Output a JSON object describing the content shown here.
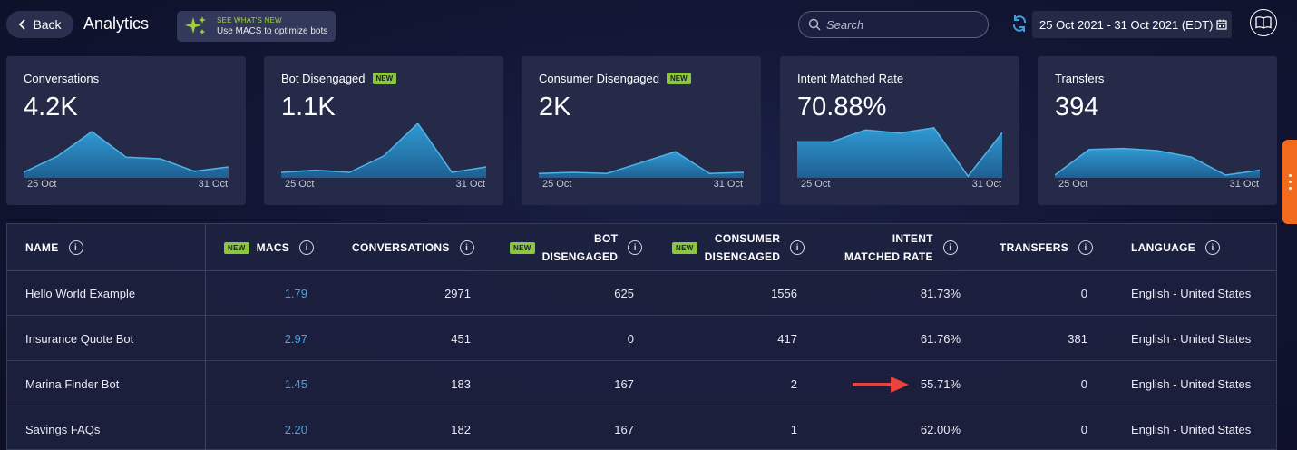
{
  "header": {
    "back_label": "Back",
    "title": "Analytics",
    "promo_top": "SEE WHAT'S NEW",
    "promo_bottom": "Use MACS to optimize bots",
    "search_placeholder": "Search",
    "date_range": "25 Oct 2021 - 31 Oct 2021 (EDT)"
  },
  "badge_text": "NEW",
  "cards": [
    {
      "title": "Conversations",
      "value": "4.2K",
      "new": false,
      "x_start": "25 Oct",
      "x_end": "31 Oct",
      "series": [
        10,
        40,
        85,
        38,
        35,
        12,
        20
      ],
      "y_max": 100
    },
    {
      "title": "Bot Disengaged",
      "value": "1.1K",
      "new": true,
      "x_start": "25 Oct",
      "x_end": "31 Oct",
      "series": [
        10,
        14,
        10,
        40,
        100,
        10,
        20
      ],
      "y_max": 100
    },
    {
      "title": "Consumer Disengaged",
      "value": "2K",
      "new": true,
      "x_start": "25 Oct",
      "x_end": "31 Oct",
      "series": [
        8,
        10,
        8,
        28,
        48,
        8,
        10
      ],
      "y_max": 100
    },
    {
      "title": "Intent Matched Rate",
      "value": "70.88%",
      "new": false,
      "x_start": "25 Oct",
      "x_end": "31 Oct",
      "series": [
        66,
        66,
        88,
        82,
        92,
        3,
        83
      ],
      "y_max": 100
    },
    {
      "title": "Transfers",
      "value": "394",
      "new": false,
      "x_start": "25 Oct",
      "x_end": "31 Oct",
      "series": [
        5,
        52,
        54,
        50,
        38,
        5,
        14
      ],
      "y_max": 100
    }
  ],
  "table": {
    "headers": {
      "name": "NAME",
      "macs": "MACS",
      "conversations": "CONVERSATIONS",
      "bot_disengaged_1": "BOT",
      "bot_disengaged_2": "DISENGAGED",
      "consumer_disengaged_1": "CONSUMER",
      "consumer_disengaged_2": "DISENGAGED",
      "intent_1": "INTENT",
      "intent_2": "MATCHED RATE",
      "transfers": "TRANSFERS",
      "language": "LANGUAGE"
    },
    "rows": [
      {
        "name": "Hello World Example",
        "macs": "1.79",
        "conversations": "2971",
        "bot_disengaged": "625",
        "consumer_disengaged": "1556",
        "intent_matched_rate": "81.73%",
        "transfers": "0",
        "language": "English - United States"
      },
      {
        "name": "Insurance Quote Bot",
        "macs": "2.97",
        "conversations": "451",
        "bot_disengaged": "0",
        "consumer_disengaged": "417",
        "intent_matched_rate": "61.76%",
        "transfers": "381",
        "language": "English - United States"
      },
      {
        "name": "Marina Finder Bot",
        "macs": "1.45",
        "conversations": "183",
        "bot_disengaged": "167",
        "consumer_disengaged": "2",
        "intent_matched_rate": "55.71%",
        "transfers": "0",
        "language": "English - United States"
      },
      {
        "name": "Savings FAQs",
        "macs": "2.20",
        "conversations": "182",
        "bot_disengaged": "167",
        "consumer_disengaged": "1",
        "intent_matched_rate": "62.00%",
        "transfers": "0",
        "language": "English - United States"
      }
    ]
  },
  "colors": {
    "accent_link": "#3fa8e6",
    "badge": "#8cc63f",
    "chart_fill": "#2b8fc4",
    "annotation_arrow": "#e8423c",
    "side_handle": "#f26a1b"
  }
}
